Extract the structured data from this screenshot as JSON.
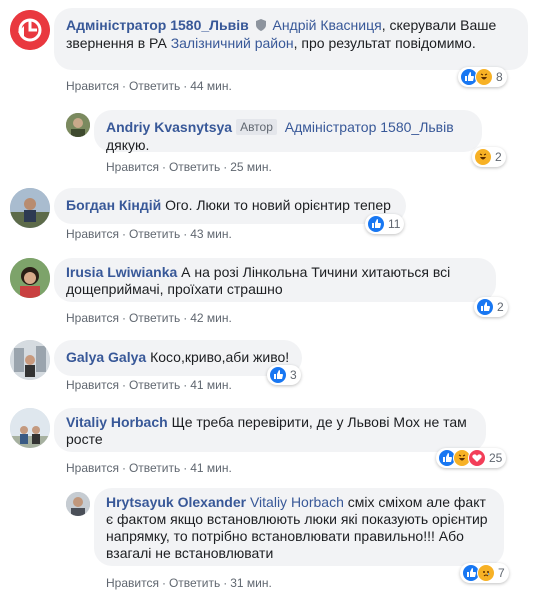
{
  "actions": {
    "like": "Нравится",
    "reply": "Ответить",
    "sep": "·"
  },
  "comments": [
    {
      "author": "Адміністратор 1580_Львів",
      "tag": "Андрій Квасниця",
      "text1": ", скерували Ваше звернення в РА ",
      "link": "Залізничний район",
      "text2": ", про результат повідомимо.",
      "time": "44 мин.",
      "reactions": "8"
    },
    {
      "author": "Andriy Kvasnytsya",
      "badge": "Автор",
      "tag": "Адміністратор 1580_Львів",
      "text": "дякую.",
      "time": "25 мин.",
      "reactions": "2"
    },
    {
      "author": "Богдан Кіндій",
      "text": "Ого. Люки то новий орієнтир тепер",
      "time": "43 мин.",
      "reactions": "11"
    },
    {
      "author": "Irusia Lwiwianka",
      "text": "А на розі Лінкольна Тичини хитаються всі дощеприймачі, проїхати страшно",
      "time": "42 мин.",
      "reactions": "2"
    },
    {
      "author": "Galya Galya",
      "text": "Косо,криво,аби живо!",
      "time": "41 мин.",
      "reactions": "3"
    },
    {
      "author": "Vitaliy Horbach",
      "text": "Ще треба перевірити, де у Львові Мох не там росте",
      "time": "41 мин.",
      "reactions": "25"
    },
    {
      "author": "Hrytsayuk Olexander",
      "tag": "Vitaliy Horbach",
      "text": "сміх сміхом але факт є фактом якщо встановлюють люки які показують орієнтир напрямку, то потрібно встановлювати правильно!!! Або взагалі не встановлювати",
      "time": "31 мин.",
      "reactions": "7"
    }
  ]
}
